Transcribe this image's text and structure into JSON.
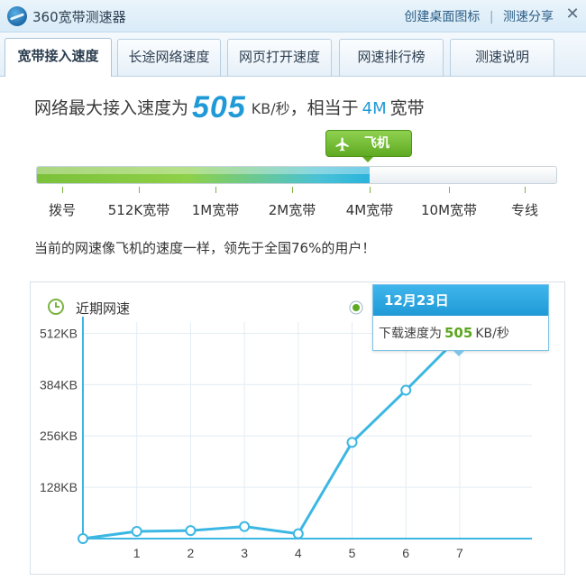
{
  "titlebar": {
    "app_title": "360宽带测速器",
    "link_desktop": "创建桌面图标",
    "separator": "|",
    "link_share": "测速分享",
    "close_glyph": "✕"
  },
  "tabs": [
    {
      "label": "宽带接入速度",
      "active": true
    },
    {
      "label": "长途网络速度",
      "active": false
    },
    {
      "label": "网页打开速度",
      "active": false
    },
    {
      "label": "网速排行榜",
      "active": false
    },
    {
      "label": "测速说明",
      "active": false
    }
  ],
  "headline": {
    "prefix": "网络最大接入速度为",
    "speed": "505",
    "unit": "KB/秒",
    "middle": "，相当于",
    "bandwidth": "4M",
    "suffix": "宽带"
  },
  "badge": {
    "icon": "plane-icon",
    "label": "飞机"
  },
  "speed_scale": {
    "fill_fraction": 0.64,
    "labels": [
      "拨号",
      "512K宽带",
      "1M宽带",
      "2M宽带",
      "4M宽带",
      "10M宽带",
      "专线"
    ]
  },
  "message": "当前的网速像飞机的速度一样，领先于全国76%的用户！",
  "chart_panel": {
    "title": "近期网速",
    "title_icon": "clock-icon"
  },
  "tooltip": {
    "date": "12月23日",
    "label": "下载速度为",
    "value": "505",
    "unit": "KB/秒"
  },
  "colors": {
    "accent_blue": "#1f9ad6",
    "accent_green": "#5faa22",
    "line": "#3cb7e3"
  },
  "chart_data": {
    "type": "line",
    "title": "近期网速",
    "x": [
      0,
      1,
      2,
      3,
      4,
      5,
      6,
      7
    ],
    "x_tick_labels": [
      "1",
      "2",
      "3",
      "4",
      "5",
      "6",
      "7"
    ],
    "y_tick_values": [
      128,
      256,
      384,
      512
    ],
    "y_tick_labels": [
      "128KB",
      "256KB",
      "384KB",
      "512KB"
    ],
    "ylim": [
      0,
      540
    ],
    "series": [
      {
        "values": [
          0,
          18,
          20,
          30,
          12,
          240,
          370,
          505
        ]
      }
    ],
    "grid": true
  }
}
